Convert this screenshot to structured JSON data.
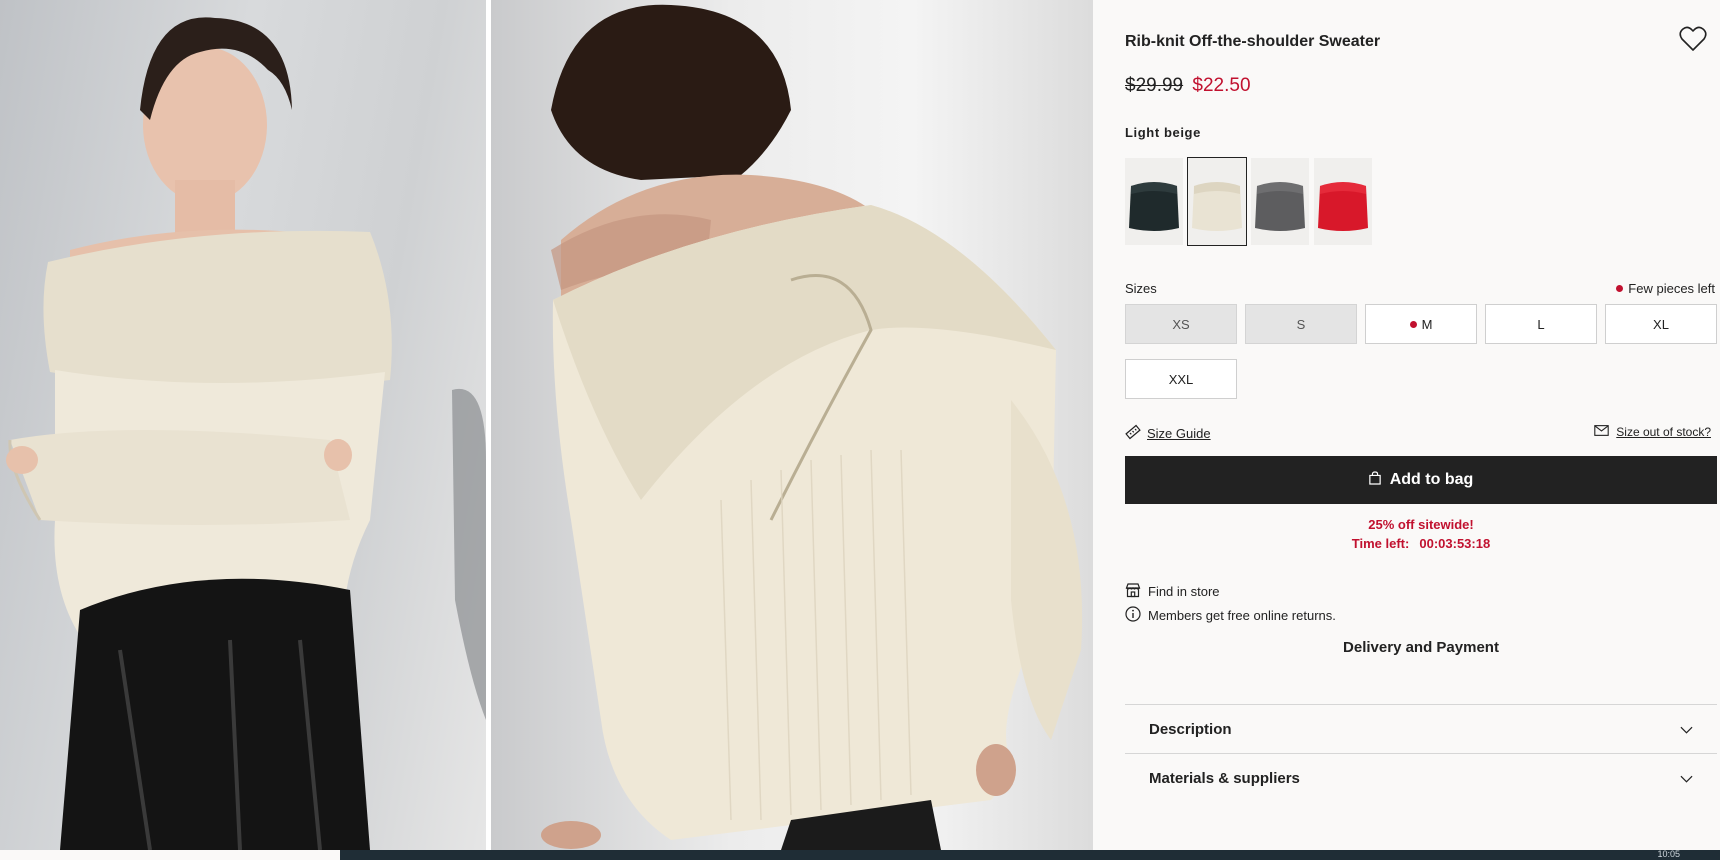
{
  "product": {
    "title": "Rib-knit Off-the-shoulder Sweater",
    "old_price": "$29.99",
    "new_price": "$22.50",
    "selected_color": "Light beige"
  },
  "icons": {
    "favorite": "heart-icon",
    "size_guide": "ruler-icon",
    "size_oos": "envelope-icon",
    "bag": "shopping-bag-icon",
    "store": "store-icon",
    "info": "info-icon",
    "chevron": "chevron-down-icon"
  },
  "swatches": [
    {
      "name": "black",
      "color": "#1f2a2c",
      "selected": false
    },
    {
      "name": "light-beige",
      "color": "#e9e3d3",
      "selected": true
    },
    {
      "name": "dark-grey",
      "color": "#5d5d5f",
      "selected": false
    },
    {
      "name": "red",
      "color": "#d8182a",
      "selected": false
    }
  ],
  "sizes": {
    "label": "Sizes",
    "stock_note": "Few pieces left",
    "options": [
      {
        "label": "XS",
        "available": false,
        "few_left": false
      },
      {
        "label": "S",
        "available": false,
        "few_left": false
      },
      {
        "label": "M",
        "available": true,
        "few_left": true
      },
      {
        "label": "L",
        "available": true,
        "few_left": false
      },
      {
        "label": "XL",
        "available": true,
        "few_left": false
      },
      {
        "label": "XXL",
        "available": true,
        "few_left": false
      }
    ]
  },
  "links": {
    "size_guide": "Size Guide",
    "size_out_of_stock": "Size out of stock?"
  },
  "add_to_bag": "Add to bag",
  "promo": {
    "headline": "25% off sitewide!",
    "time_label": "Time left:",
    "time_value": "00:03:53:18"
  },
  "info": {
    "find_in_store": "Find in store",
    "returns": "Members get free online returns."
  },
  "delivery": "Delivery and Payment",
  "accordions": {
    "description": "Description",
    "materials": "Materials & suppliers"
  },
  "bottom_bar": {
    "text": "10:05"
  },
  "colors": {
    "accent_red": "#c1112f",
    "button_dark": "#222222",
    "background": "#faf9f8"
  }
}
